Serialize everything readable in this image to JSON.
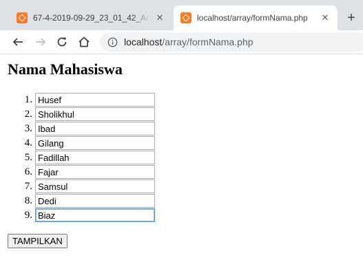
{
  "tabs": [
    {
      "title": "67-4-2019-09-29_23_01_42_Array",
      "close_glyph": "✕",
      "favicon": "xampp-icon"
    },
    {
      "title": "localhost/array/formNama.php",
      "close_glyph": "✕",
      "favicon": "xampp-icon"
    }
  ],
  "new_tab_glyph": "+",
  "toolbar": {
    "url_host": "localhost",
    "url_path": "/array/formNama.php"
  },
  "page": {
    "heading": "Nama Mahasiswa",
    "list_numbers": [
      "1.",
      "2.",
      "3.",
      "4.",
      "5.",
      "6.",
      "7.",
      "8.",
      "9."
    ],
    "names": [
      "Husef",
      "Sholikhul",
      "Ibad",
      "Gilang",
      "Fadillah",
      "Fajar",
      "Samsul",
      "Dedi",
      "Biaz"
    ],
    "submit_label": "TAMPILKAN"
  },
  "colors": {
    "tabstrip": "#dee1e6",
    "favicon": "#fb7a24",
    "focus_ring": "#5b8fe0"
  }
}
